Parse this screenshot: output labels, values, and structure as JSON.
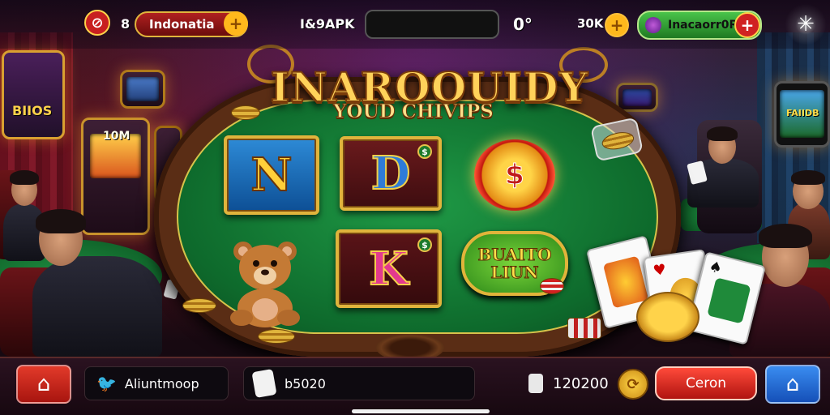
{
  "topbar": {
    "no_sound_icon": "mute-icon",
    "level": "8",
    "region_label": "Indonatia",
    "apk_label": "I&9APK",
    "status_text": "0°",
    "coins_label": "30K",
    "profile_label": "Inacaorr0R",
    "plus_symbol": "+",
    "settings_icon": "sparkle-icon"
  },
  "banner": {
    "title": "INAROOUIDY",
    "subtitle": "YOUD CHIVIPS"
  },
  "tiles": {
    "tile1_letter": "N",
    "tile2_letter": "D",
    "tile2_badge": "$",
    "tile3_symbol": "$",
    "tile4_letter": "K",
    "tile4_badge": "$",
    "bonus_line1": "BUAITO",
    "bonus_line2": "LIUN"
  },
  "side_signs": {
    "left_sign": "BIIOS",
    "slot_sign": "10M",
    "right_sign": "FAIIDB"
  },
  "bottombar": {
    "home_icon": "home-icon",
    "social_icon": "twitter-icon",
    "social_label": "Aliuntmoop",
    "chat_icon": "hand-icon",
    "chat_value": "b5020",
    "trophy_icon": "reward-icon",
    "balance": "120200",
    "coin_icon": "coin-icon",
    "action_label": "Ceron",
    "nav_icon": "house-icon"
  },
  "colors": {
    "felt": "#0e6a2c",
    "gold": "#e0b43c",
    "red_button": "#c8231d",
    "green_button": "#2f9a2a",
    "blue_button": "#1f6ad0"
  }
}
